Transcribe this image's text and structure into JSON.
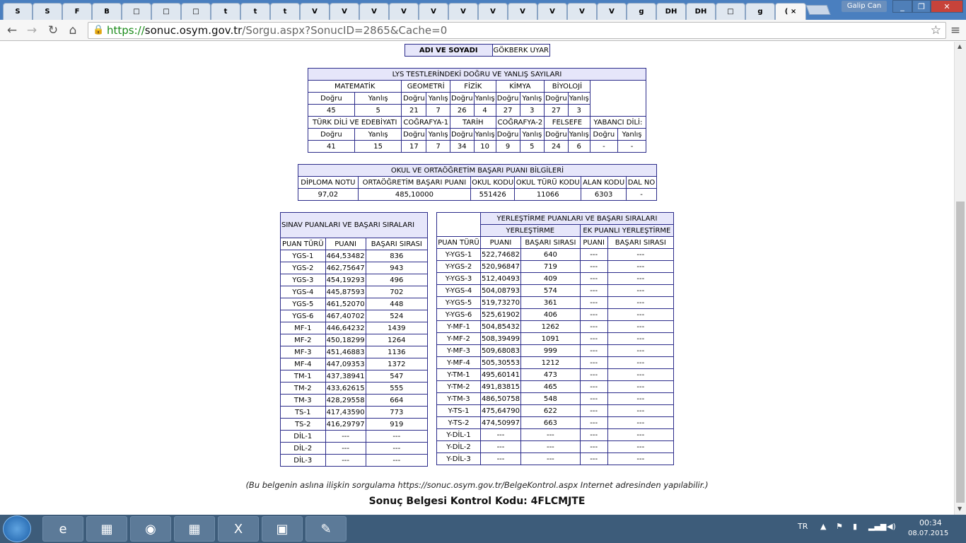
{
  "browser": {
    "tab_active_label": "(",
    "close_glyph": "×",
    "user": "Galip Can",
    "url_https": "https://",
    "url_host": "sonuc.osym.gov.tr",
    "url_path": "/Sorgu.aspx?SonucID=2865&Cache=0",
    "back": "←",
    "forward": "→",
    "reload": "↻",
    "home": "⌂",
    "star": "☆",
    "menu": "≡"
  },
  "tabs": [
    "S",
    "S",
    "F",
    "B",
    "□",
    "□",
    "□",
    "t",
    "t",
    "t",
    "V",
    "V",
    "V",
    "V",
    "V",
    "V",
    "V",
    "V",
    "V",
    "V",
    "V",
    "g",
    "DH",
    "DH",
    "□",
    "g"
  ],
  "name_label": "ADI VE SOYADI",
  "name_value": "GÖKBERK UYAR",
  "lys": {
    "title": "LYS TESTLERİNDEKİ DOĞRU VE YANLIŞ SAYILARI",
    "row1_subjects": [
      "MATEMATİK",
      "GEOMETRİ",
      "FİZİK",
      "KİMYA",
      "BİYOLOJİ"
    ],
    "dogru": "Doğru",
    "yanlis": "Yanlış",
    "row1_values": [
      "45",
      "5",
      "21",
      "7",
      "26",
      "4",
      "27",
      "3",
      "27",
      "3"
    ],
    "row2_subjects": [
      "TÜRK DİLİ VE EDEBİYATI",
      "COĞRAFYA-1",
      "TARİH",
      "COĞRAFYA-2",
      "FELSEFE",
      "YABANCI DİLİ:"
    ],
    "row2_values": [
      "41",
      "15",
      "17",
      "7",
      "34",
      "10",
      "9",
      "5",
      "24",
      "6",
      "-",
      "-"
    ]
  },
  "okul": {
    "title": "OKUL VE ORTAÖĞRETİM BAŞARI PUANI BİLGİLERİ",
    "headers": [
      "DİPLOMA NOTU",
      "ORTAÖĞRETİM BAŞARI PUANI",
      "OKUL KODU",
      "OKUL TÜRÜ KODU",
      "ALAN KODU",
      "DAL NO"
    ],
    "values": [
      "97,02",
      "485,10000",
      "551426",
      "11066",
      "6303",
      "-"
    ]
  },
  "sinav": {
    "title": "SINAV PUANLARI VE BAŞARI SIRALARI",
    "headers": [
      "PUAN TÜRÜ",
      "PUANI",
      "BAŞARI SIRASI"
    ],
    "rows": [
      [
        "YGS-1",
        "464,53482",
        "836"
      ],
      [
        "YGS-2",
        "462,75647",
        "943"
      ],
      [
        "YGS-3",
        "454,19293",
        "496"
      ],
      [
        "YGS-4",
        "445,87593",
        "702"
      ],
      [
        "YGS-5",
        "461,52070",
        "448"
      ],
      [
        "YGS-6",
        "467,40702",
        "524"
      ],
      [
        "MF-1",
        "446,64232",
        "1439"
      ],
      [
        "MF-2",
        "450,18299",
        "1264"
      ],
      [
        "MF-3",
        "451,46883",
        "1136"
      ],
      [
        "MF-4",
        "447,09353",
        "1372"
      ],
      [
        "TM-1",
        "437,38941",
        "547"
      ],
      [
        "TM-2",
        "433,62615",
        "555"
      ],
      [
        "TM-3",
        "428,29558",
        "664"
      ],
      [
        "TS-1",
        "417,43590",
        "773"
      ],
      [
        "TS-2",
        "416,29797",
        "919"
      ],
      [
        "DİL-1",
        "---",
        "---"
      ],
      [
        "DİL-2",
        "---",
        "---"
      ],
      [
        "DİL-3",
        "---",
        "---"
      ]
    ]
  },
  "yer": {
    "title": "YERLEŞTİRME PUANLARI VE BAŞARI SIRALARI",
    "sub1": "YERLEŞTİRME",
    "sub2": "EK PUANLI YERLEŞTİRME",
    "headers": [
      "PUAN TÜRÜ",
      "PUANI",
      "BAŞARI SIRASI",
      "PUANI",
      "BAŞARI SIRASI"
    ],
    "rows": [
      [
        "Y-YGS-1",
        "522,74682",
        "640",
        "---",
        "---"
      ],
      [
        "Y-YGS-2",
        "520,96847",
        "719",
        "---",
        "---"
      ],
      [
        "Y-YGS-3",
        "512,40493",
        "409",
        "---",
        "---"
      ],
      [
        "Y-YGS-4",
        "504,08793",
        "574",
        "---",
        "---"
      ],
      [
        "Y-YGS-5",
        "519,73270",
        "361",
        "---",
        "---"
      ],
      [
        "Y-YGS-6",
        "525,61902",
        "406",
        "---",
        "---"
      ],
      [
        "Y-MF-1",
        "504,85432",
        "1262",
        "---",
        "---"
      ],
      [
        "Y-MF-2",
        "508,39499",
        "1091",
        "---",
        "---"
      ],
      [
        "Y-MF-3",
        "509,68083",
        "999",
        "---",
        "---"
      ],
      [
        "Y-MF-4",
        "505,30553",
        "1212",
        "---",
        "---"
      ],
      [
        "Y-TM-1",
        "495,60141",
        "473",
        "---",
        "---"
      ],
      [
        "Y-TM-2",
        "491,83815",
        "465",
        "---",
        "---"
      ],
      [
        "Y-TM-3",
        "486,50758",
        "548",
        "---",
        "---"
      ],
      [
        "Y-TS-1",
        "475,64790",
        "622",
        "---",
        "---"
      ],
      [
        "Y-TS-2",
        "474,50997",
        "663",
        "---",
        "---"
      ],
      [
        "Y-DİL-1",
        "---",
        "---",
        "---",
        "---"
      ],
      [
        "Y-DİL-2",
        "---",
        "---",
        "---",
        "---"
      ],
      [
        "Y-DİL-3",
        "---",
        "---",
        "---",
        "---"
      ]
    ]
  },
  "note": "(Bu belgenin aslına ilişkin sorgulama https://sonuc.osym.gov.tr/BelgeKontrol.aspx Internet adresinden yapılabilir.)",
  "control_code": "Sonuç Belgesi Kontrol Kodu: 4FLCMJTE",
  "taskbar": {
    "lang": "TR",
    "time": "00:34",
    "date": "08.07.2015",
    "apps": [
      "e",
      "▦",
      "◉",
      "▦",
      "X",
      "▣",
      "✎"
    ]
  }
}
